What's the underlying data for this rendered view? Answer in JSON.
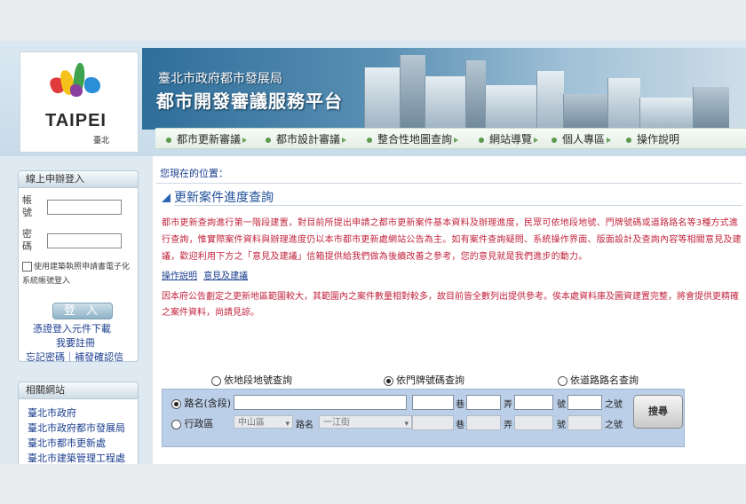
{
  "header": {
    "logo_word": "TAIPEI",
    "logo_sub": "臺北",
    "dept": "臺北市政府都市發展局",
    "platform": "都市開發審議服務平台"
  },
  "nav": {
    "items": [
      "都市更新審議",
      "都市設計審議",
      "整合性地圖查詢",
      "網站導覽",
      "個人專區",
      "操作說明"
    ]
  },
  "sidebar": {
    "login": {
      "title": "線上申辦登入",
      "account_label": "帳號",
      "password_label": "密碼",
      "checkbox_label": "使用建築執照申請書電子化系統帳號登入",
      "button_label": "登 入",
      "cert_download": "憑證登入元件下載",
      "register": "我要註冊",
      "forgot": "忘記密碼｜補發確認信"
    },
    "related": {
      "title": "相關網站",
      "links": [
        "臺北市政府",
        "臺北市政府都市發展局",
        "臺北市都市更新處",
        "臺北市建築管理工程處"
      ]
    }
  },
  "main": {
    "breadcrumb": "您現在的位置：",
    "title": "更新案件進度查詢",
    "description": "都市更新查詢進行第一階段建置，對目前所提出申請之都市更新案件基本資料及辦理進度，民眾可依地段地號、門牌號碼或道路路名等3種方式進行查詢，惟實際案件資料與辦理進度仍以本市都市更新處網站公告為主。如有案件查詢疑問、系統操作界面、版面設計及查詢內容等相關意見及建議，歡迎利用下方之「意見及建議」信箱提供給我們做為後續改善之參考，您的意見就是我們進步的動力。",
    "links": [
      "操作說明",
      "意見及建議"
    ],
    "notice": "因本府公告劃定之更新地區範圍較大，其範圍內之案件數量相對較多，故目前皆全數列出提供參考。俟本處資料庫及圖資建置完整，將會提供更精確之案件資料，尚請見諒。",
    "query_types": [
      "依地段地號查詢",
      "依門牌號碼查詢",
      "依道路路名查詢"
    ],
    "query_selected": "依門牌號碼查詢"
  },
  "search": {
    "row1_label": "路名(含段)",
    "row2_label": "行政區",
    "district_value": "中山區",
    "road_label": "路名",
    "road_value": "一江街",
    "lane": "巷",
    "alley": "弄",
    "number": "號",
    "sub_number": "之號",
    "button": "搜尋"
  }
}
